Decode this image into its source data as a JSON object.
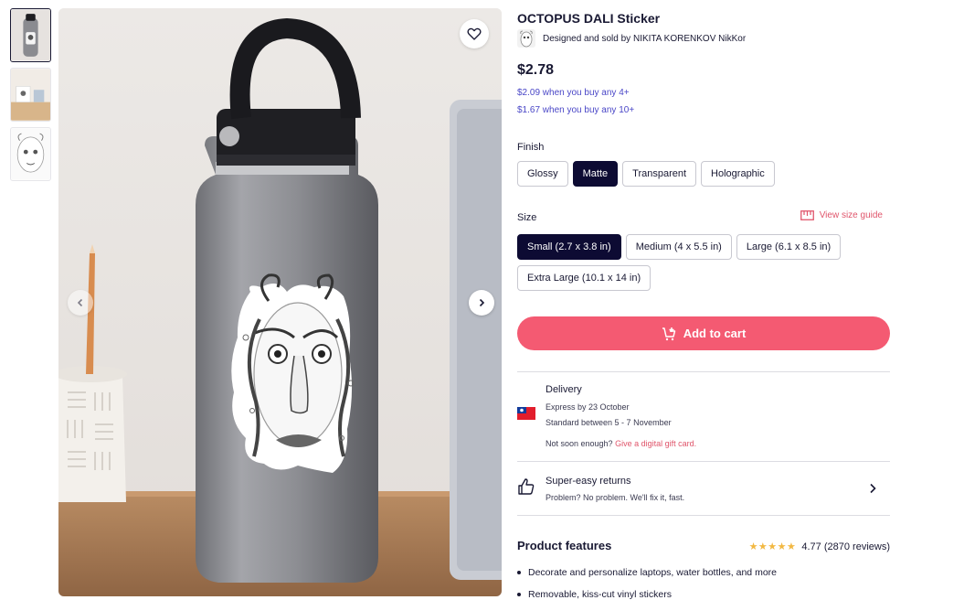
{
  "product": {
    "title": "OCTOPUS DALI Sticker",
    "designed_prefix": "Designed and sold by",
    "artist": "NIKITA KORENKOV NikKor",
    "price": "$2.78",
    "bulk_4": "$2.09 when you buy any 4+",
    "bulk_10": "$1.67 when you buy any 10+"
  },
  "finish": {
    "label": "Finish",
    "options": [
      "Glossy",
      "Matte",
      "Transparent",
      "Holographic"
    ],
    "selected": "Matte"
  },
  "size": {
    "label": "Size",
    "guide_label": "View size guide",
    "options": [
      "Small (2.7 x 3.8 in)",
      "Medium (4 x 5.5 in)",
      "Large (6.1 x 8.5 in)",
      "Extra Large (10.1 x 14 in)"
    ],
    "selected": "Small (2.7 x 3.8 in)"
  },
  "cart": {
    "label": "Add to cart"
  },
  "delivery": {
    "title": "Delivery",
    "express": "Express by 23 October",
    "standard": "Standard between 5 - 7 November",
    "not_soon": "Not soon enough?",
    "gift_link": "Give a digital gift card."
  },
  "returns": {
    "title": "Super-easy returns",
    "subtitle": "Problem? No problem. We'll fix it, fast."
  },
  "features": {
    "title": "Product features",
    "rating": "4.77",
    "reviews": "(2870 reviews)",
    "items": [
      "Decorate and personalize laptops, water bottles, and more",
      "Removable, kiss-cut vinyl stickers"
    ]
  },
  "icons": {
    "favorite": "heart-icon",
    "prev": "chevron-left-icon",
    "next": "chevron-right-icon",
    "size_guide": "ruler-icon",
    "cart": "cart-add-icon",
    "flag": "taiwan-flag-icon",
    "returns": "thumbs-up-icon",
    "returns_chevron": "chevron-right-icon"
  },
  "colors": {
    "accent": "#f45a72",
    "selected": "#0d0b33",
    "link": "#4a47c7",
    "star": "#f2b842"
  }
}
